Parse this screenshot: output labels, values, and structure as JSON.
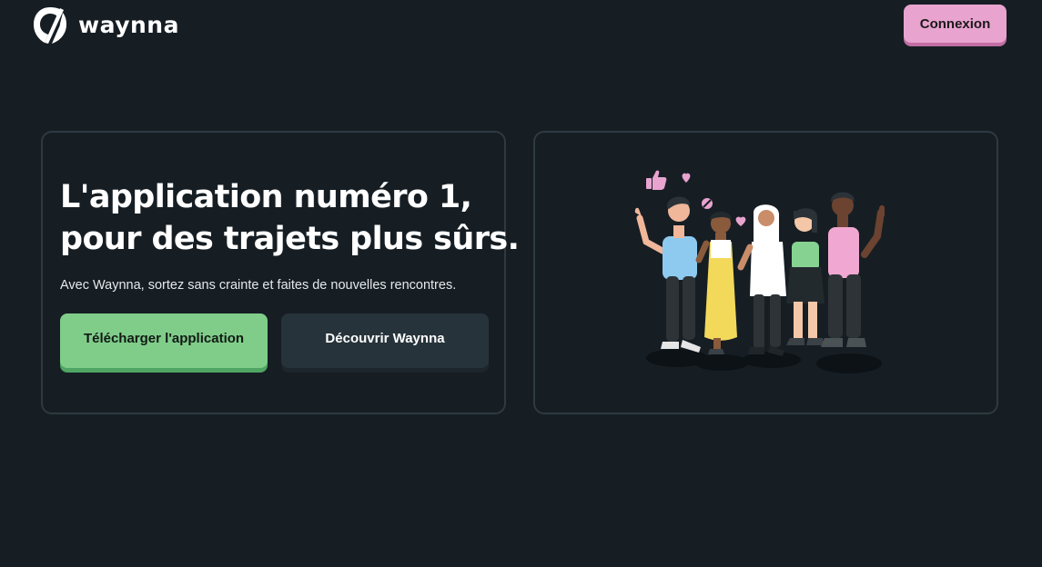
{
  "header": {
    "brand": "waynna",
    "login_label": "Connexion"
  },
  "hero": {
    "title_line1": "L'application numéro 1,",
    "title_line2": "pour des trajets plus sûrs.",
    "subtitle": "Avec Waynna, sortez sans crainte et faites de nouvelles rencontres.",
    "download_label": "Télécharger l'application",
    "discover_label": "Découvrir Waynna"
  },
  "illustration": {
    "icons": [
      "thumbs-up-icon",
      "heart-icon",
      "no-entry-icon"
    ]
  },
  "colors": {
    "background": "#161e24",
    "card_border": "#2e3a41",
    "login_button": "#e9a3cf",
    "download_button": "#80cd8a",
    "discover_button": "#27333a"
  }
}
